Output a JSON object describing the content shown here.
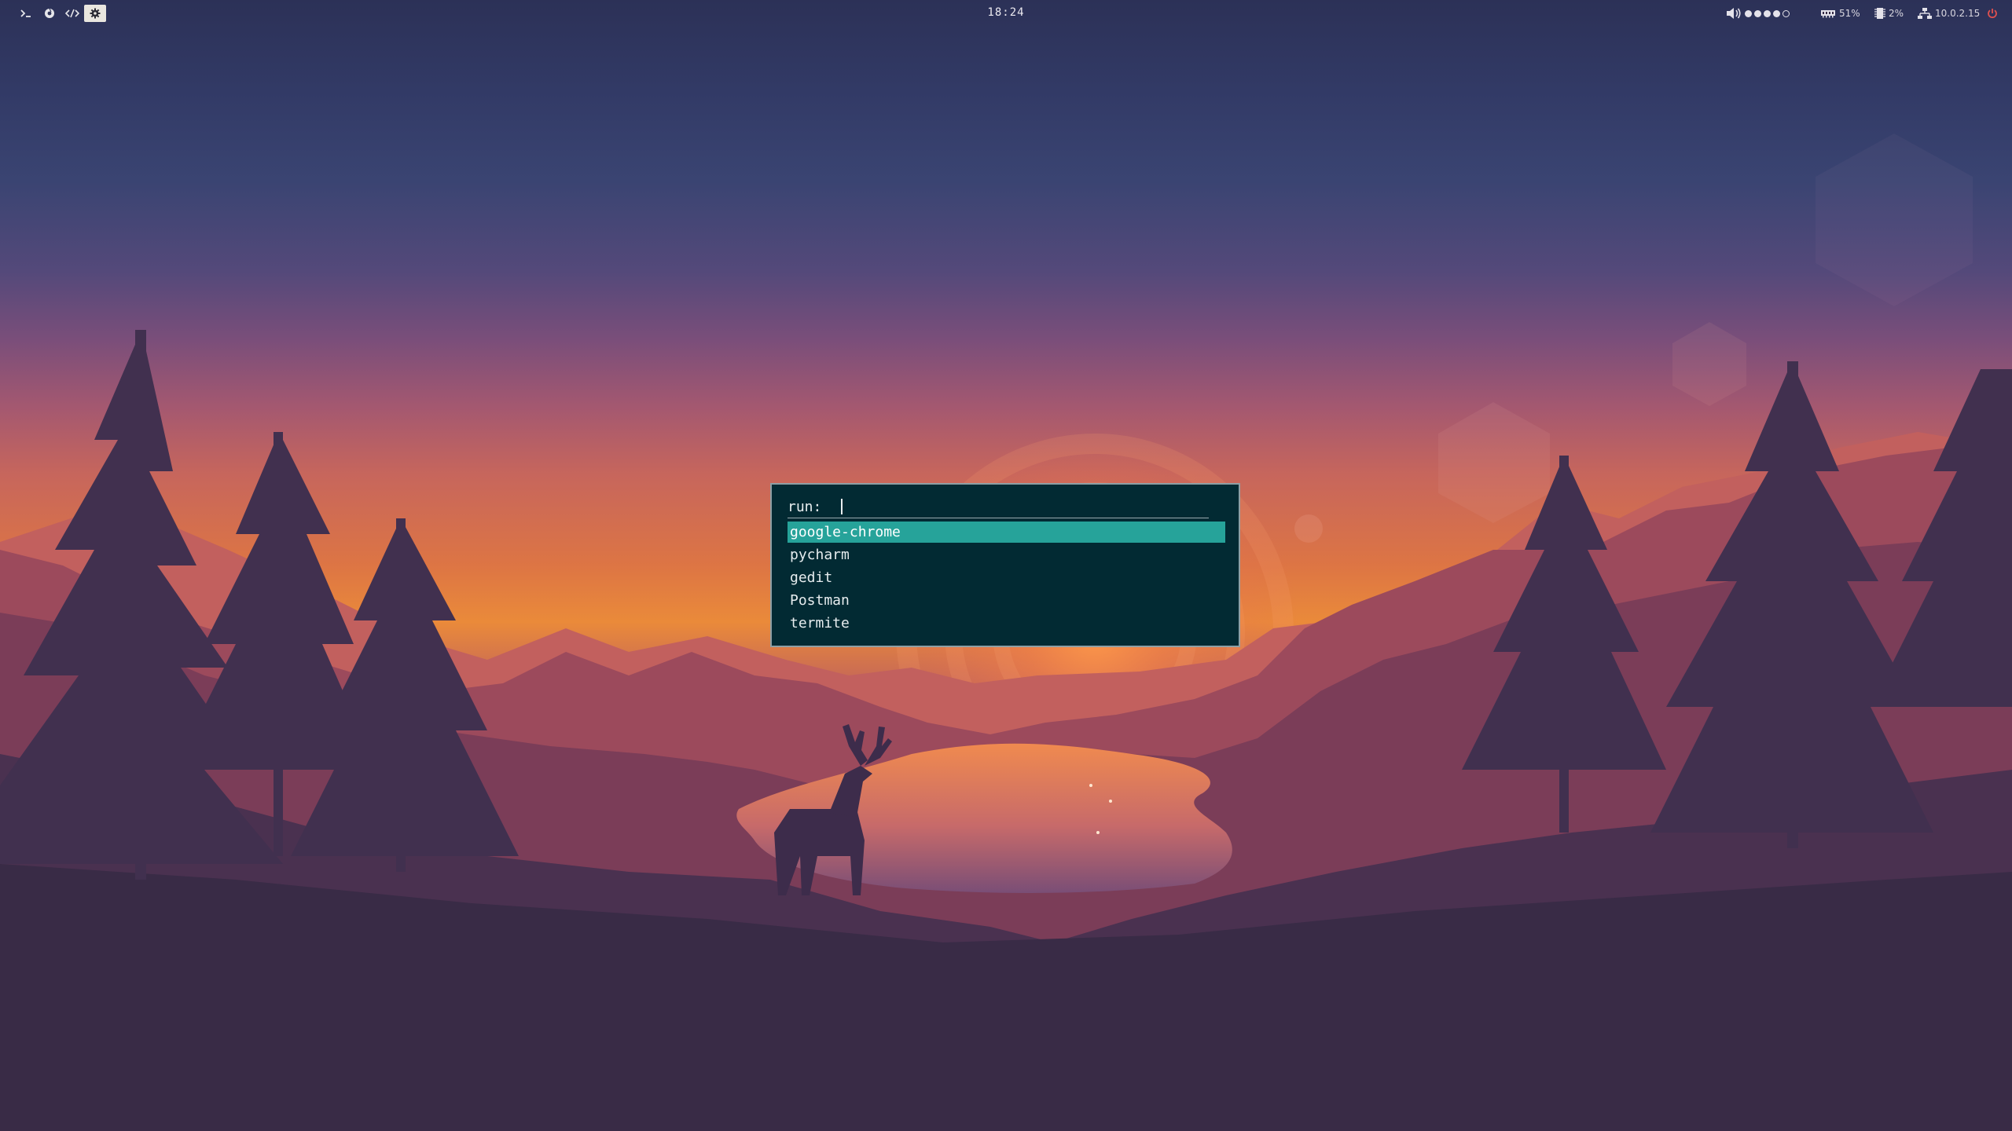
{
  "topbar": {
    "workspaces": [
      {
        "icon": "terminal-icon",
        "active": false
      },
      {
        "icon": "globe-icon",
        "active": false
      },
      {
        "icon": "code-icon",
        "active": false
      },
      {
        "icon": "gear-icon",
        "active": true
      }
    ],
    "clock": "18:24",
    "tray": {
      "volume": {
        "icon": "speaker-icon",
        "level_filled": 4,
        "level_total": 5
      },
      "memory": {
        "icon": "memory-icon",
        "value": "51%"
      },
      "cpu": {
        "icon": "cpu-icon",
        "value": "2%"
      },
      "network": {
        "icon": "network-icon",
        "value": "10.0.2.15"
      },
      "power": {
        "icon": "power-icon"
      }
    }
  },
  "launcher": {
    "prompt": "run:",
    "input_value": "",
    "results": [
      {
        "label": "google-chrome",
        "selected": true
      },
      {
        "label": "pycharm",
        "selected": false
      },
      {
        "label": "gedit",
        "selected": false
      },
      {
        "label": "Postman",
        "selected": false
      },
      {
        "label": "termite",
        "selected": false
      }
    ]
  },
  "colors": {
    "launcher_bg": "#022a33",
    "launcher_border": "#8e9fa5",
    "selection": "#26a39a",
    "power_red": "#e0514f",
    "active_workspace_bg": "#e9e6df"
  },
  "wallpaper": {
    "description_icon": "firewatch-deer-icon"
  }
}
